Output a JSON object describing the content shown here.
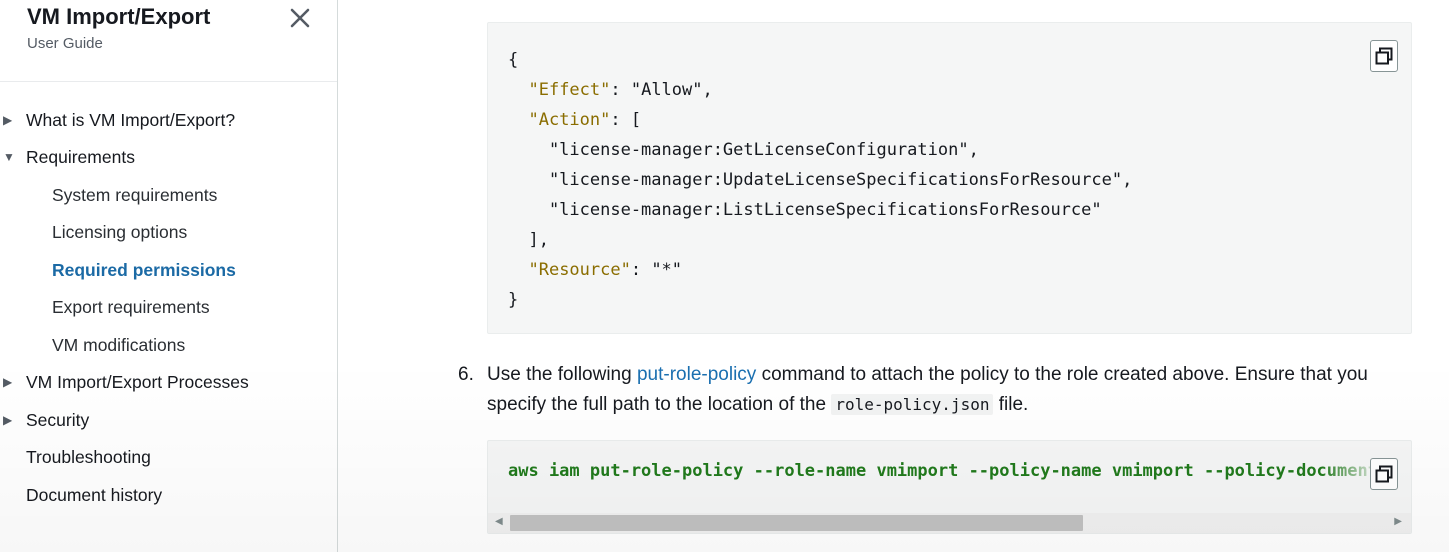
{
  "sidebar": {
    "title": "VM Import/Export",
    "subtitle": "User Guide",
    "close_icon": "close-icon",
    "items": [
      {
        "label": "What is VM Import/Export?",
        "expander": "collapsed"
      },
      {
        "label": "Requirements",
        "expander": "expanded"
      },
      {
        "label": "System requirements"
      },
      {
        "label": "Licensing options"
      },
      {
        "label": "Required permissions",
        "active": true
      },
      {
        "label": "Export requirements"
      },
      {
        "label": "VM modifications"
      },
      {
        "label": "VM Import/Export Processes",
        "expander": "collapsed"
      },
      {
        "label": "Security",
        "expander": "collapsed"
      },
      {
        "label": "Troubleshooting"
      },
      {
        "label": "Document history"
      }
    ]
  },
  "policy_code": {
    "lines": [
      "{",
      "  \"Effect\": \"Allow\",",
      "  \"Action\": [",
      "    \"license-manager:GetLicenseConfiguration\",",
      "    \"license-manager:UpdateLicenseSpecificationsForResource\",",
      "    \"license-manager:ListLicenseSpecificationsForResource\"",
      "  ],",
      "  \"Resource\": \"*\"",
      "}"
    ],
    "copy_icon": "copy-icon"
  },
  "step6": {
    "number": "6.",
    "text_before": "Use the following ",
    "link": "put-role-policy",
    "text_middle": " command to attach the policy to the role created above. Ensure that you specify the full path to the location of the ",
    "code": "role-policy.json",
    "text_after": " file."
  },
  "command": {
    "text": "aws iam put-role-policy --role-name vmimport --policy-name vmimport --policy-document",
    "copy_icon": "copy-icon"
  },
  "colors": {
    "link": "#1a6fb0",
    "active_nav": "#1b6aa5",
    "json_key": "#8a6d00",
    "command": "#217a1c",
    "code_bg": "#f5f6f6"
  }
}
